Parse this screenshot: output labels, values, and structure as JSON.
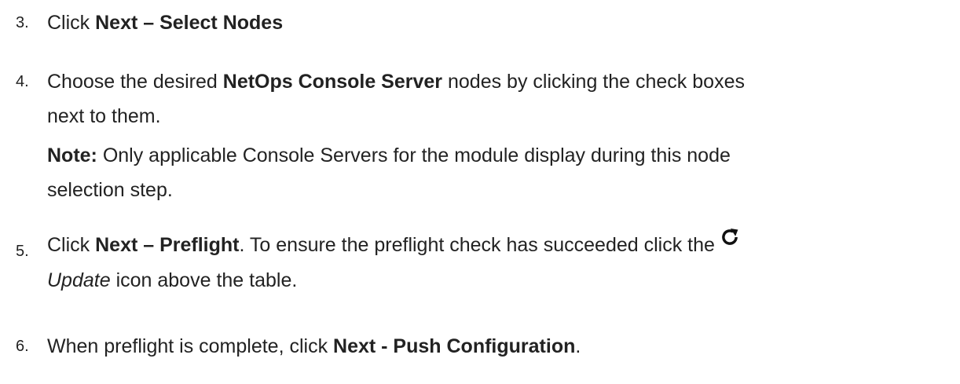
{
  "steps": [
    {
      "number": "3.",
      "text_before": "Click ",
      "bold": "Next – Select Nodes"
    },
    {
      "number": "4.",
      "text_before": "Choose the desired ",
      "bold": "NetOps Console Server",
      "text_after": " nodes by clicking the check boxes",
      "line2": "next to them.",
      "note_label": "Note:",
      "note_text": " Only applicable Console Servers for the module display during this node",
      "note_line2": "selection step."
    },
    {
      "number": "5.",
      "text_before": "Click ",
      "bold": "Next – Preflight",
      "text_after": ". To ensure the preflight check has succeeded click the",
      "icon": "refresh-icon",
      "italic": "Update",
      "line2_after": " icon above the table."
    },
    {
      "number": "6.",
      "text_before": "When preflight is complete, click ",
      "bold": "Next - Push Configuration",
      "text_after": "."
    }
  ]
}
